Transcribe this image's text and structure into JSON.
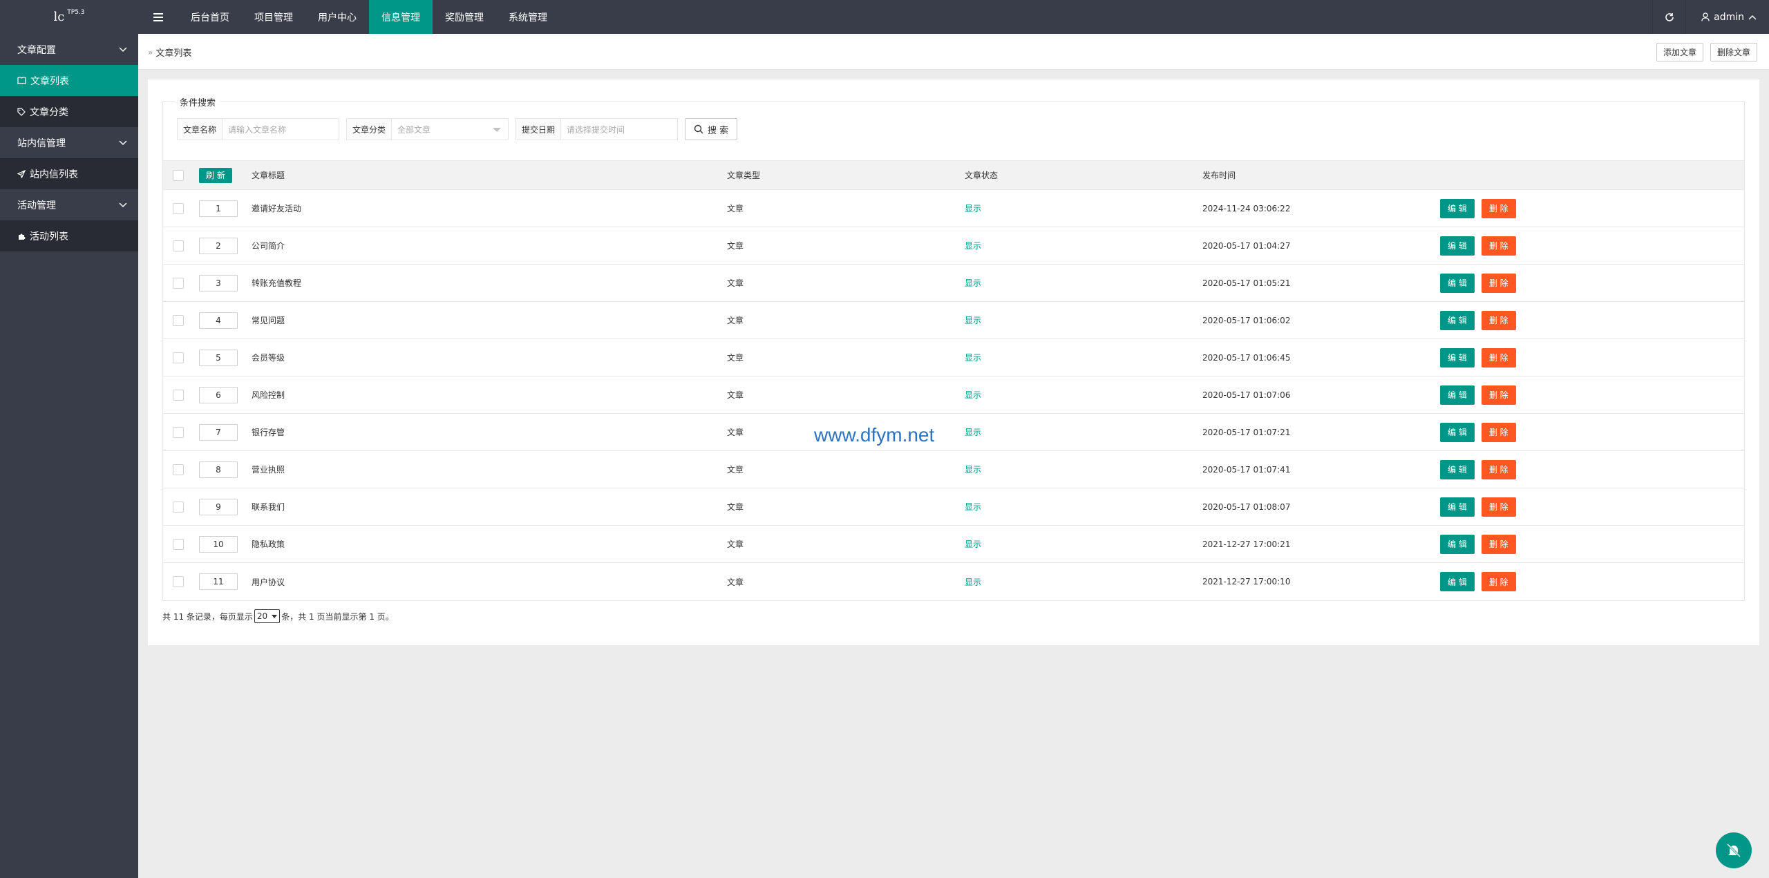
{
  "app": {
    "logo_main": "lc",
    "logo_version": "TP5.3",
    "user_name": "admin"
  },
  "top_nav": [
    {
      "label": "后台首页",
      "active": false
    },
    {
      "label": "项目管理",
      "active": false
    },
    {
      "label": "用户中心",
      "active": false
    },
    {
      "label": "信息管理",
      "active": true
    },
    {
      "label": "奖励管理",
      "active": false
    },
    {
      "label": "系统管理",
      "active": false
    }
  ],
  "sidebar": {
    "groups": [
      {
        "label": "文章配置",
        "items": [
          {
            "label": "文章列表",
            "icon": "book-icon",
            "active": true
          },
          {
            "label": "文章分类",
            "icon": "tag-icon",
            "active": false
          }
        ]
      },
      {
        "label": "站内信管理",
        "items": [
          {
            "label": "站内信列表",
            "icon": "paper-plane-icon",
            "active": false
          }
        ]
      },
      {
        "label": "活动管理",
        "items": [
          {
            "label": "活动列表",
            "icon": "puzzle-icon",
            "active": false
          }
        ]
      }
    ]
  },
  "header": {
    "breadcrumb": "文章列表",
    "add_button": "添加文章",
    "delete_button": "删除文章"
  },
  "search": {
    "legend": "条件搜索",
    "name_label": "文章名称",
    "name_placeholder": "请输入文章名称",
    "category_label": "文章分类",
    "category_value": "全部文章",
    "date_label": "提交日期",
    "date_placeholder": "请选择提交时间",
    "search_button": "搜 索"
  },
  "table": {
    "refresh_label": "刷 新",
    "columns": {
      "title": "文章标题",
      "type": "文章类型",
      "status": "文章状态",
      "time": "发布时间"
    },
    "edit_label": "编 辑",
    "delete_label": "删 除",
    "rows": [
      {
        "order": "1",
        "title": "邀请好友活动",
        "type": "文章",
        "status": "显示",
        "time": "2024-11-24 03:06:22"
      },
      {
        "order": "2",
        "title": "公司简介",
        "type": "文章",
        "status": "显示",
        "time": "2020-05-17 01:04:27"
      },
      {
        "order": "3",
        "title": "转账充值教程",
        "type": "文章",
        "status": "显示",
        "time": "2020-05-17 01:05:21"
      },
      {
        "order": "4",
        "title": "常见问题",
        "type": "文章",
        "status": "显示",
        "time": "2020-05-17 01:06:02"
      },
      {
        "order": "5",
        "title": "会员等级",
        "type": "文章",
        "status": "显示",
        "time": "2020-05-17 01:06:45"
      },
      {
        "order": "6",
        "title": "风险控制",
        "type": "文章",
        "status": "显示",
        "time": "2020-05-17 01:07:06"
      },
      {
        "order": "7",
        "title": "银行存管",
        "type": "文章",
        "status": "显示",
        "time": "2020-05-17 01:07:21"
      },
      {
        "order": "8",
        "title": "营业执照",
        "type": "文章",
        "status": "显示",
        "time": "2020-05-17 01:07:41"
      },
      {
        "order": "9",
        "title": "联系我们",
        "type": "文章",
        "status": "显示",
        "time": "2020-05-17 01:08:07"
      },
      {
        "order": "10",
        "title": "隐私政策",
        "type": "文章",
        "status": "显示",
        "time": "2021-12-27 17:00:21"
      },
      {
        "order": "11",
        "title": "用户协议",
        "type": "文章",
        "status": "显示",
        "time": "2021-12-27 17:00:10"
      }
    ]
  },
  "pagination": {
    "prefix": "共 11 条记录，每页显示",
    "page_size": "20",
    "suffix": "条，共 1 页当前显示第 1 页。"
  },
  "watermark": "www.dfym.net",
  "colors": {
    "accent": "#009688",
    "danger": "#ff5722",
    "nav_bg": "#393d49"
  }
}
